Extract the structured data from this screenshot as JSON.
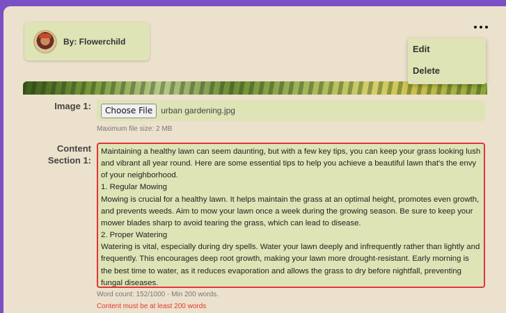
{
  "author": {
    "label": "By: Flowerchild"
  },
  "menu": {
    "items": [
      {
        "label": "Edit"
      },
      {
        "label": "Delete"
      }
    ]
  },
  "image_field": {
    "label": "Image 1:",
    "button_label": "Choose File",
    "file_name": "urban gardening.jpg",
    "hint": "Maximum file size: 2 MB"
  },
  "content_field": {
    "label_line1": "Content",
    "label_line2": "Section 1:",
    "paragraphs": [
      "Maintaining a healthy lawn can seem daunting, but with a few key tips, you can keep your grass looking lush and vibrant all year round. Here are some essential tips to help you achieve a beautiful lawn that's the envy of your neighborhood.",
      "1. Regular Mowing",
      "Mowing is crucial for a healthy lawn. It helps maintain the grass at an optimal height, promotes even growth, and prevents weeds. Aim to mow your lawn once a week during the growing season. Be sure to keep your mower blades sharp to avoid tearing the grass, which can lead to disease.",
      "2. Proper Watering",
      "Watering is vital, especially during dry spells. Water your lawn deeply and infrequently rather than lightly and frequently. This encourages deep root growth, making your lawn more drought-resistant. Early morning is the best time to water, as it reduces evaporation and allows the grass to dry before nightfall, preventing fungal diseases."
    ],
    "word_count": "Word count: 152/1000 - Min 200 words.",
    "error": "Content must be at least 200 words"
  },
  "colors": {
    "background": "#7b4fc6",
    "panel": "#ece1cc",
    "card": "#dfe4b6",
    "error": "#e03a3a"
  }
}
